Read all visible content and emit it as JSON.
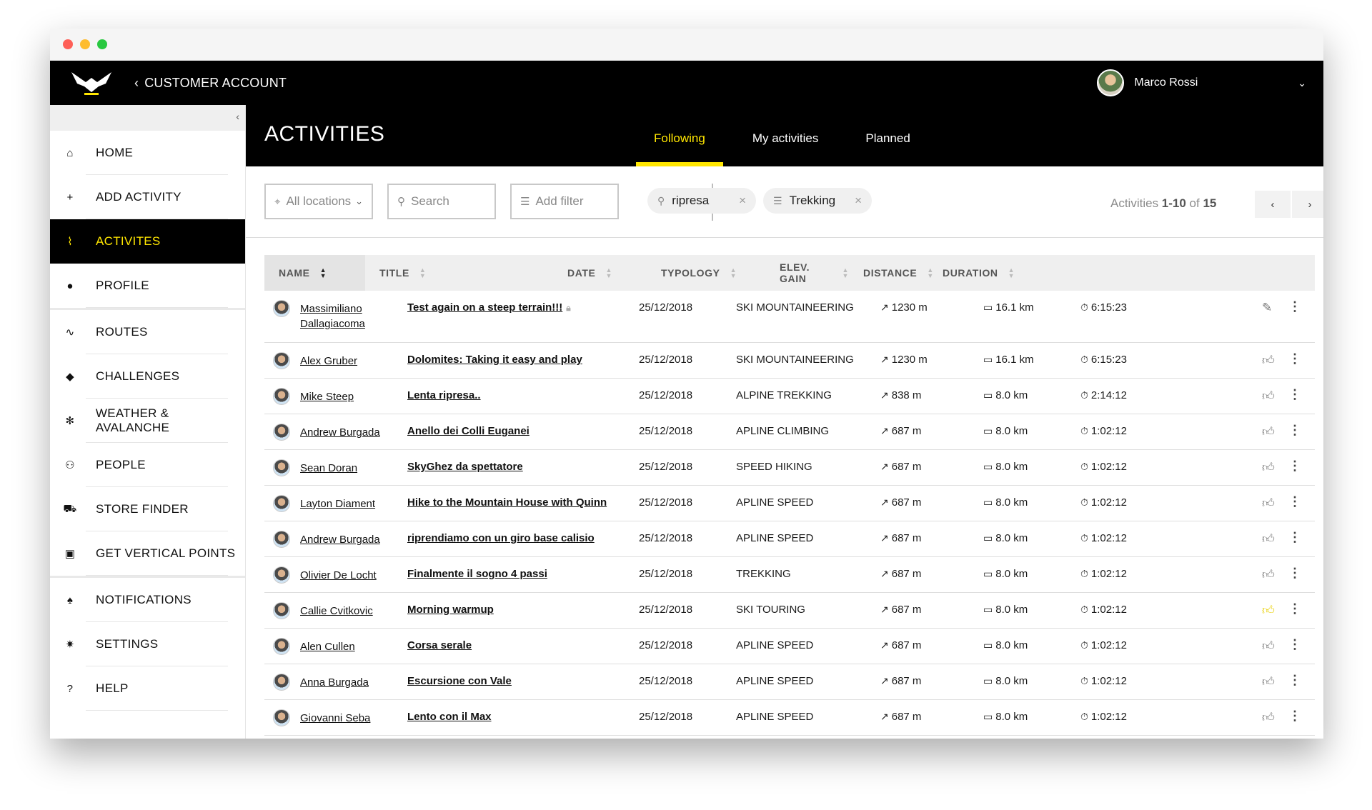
{
  "window": {
    "controls": [
      "close",
      "minimize",
      "maximize"
    ]
  },
  "topbar": {
    "logo_icon": "salewa-eagle-logo",
    "back_label": "CUSTOMER ACCOUNT",
    "user_name": "Marco Rossi"
  },
  "sidebar": {
    "items": [
      {
        "id": "home",
        "label": "HOME",
        "icon": "⌂",
        "group": 1
      },
      {
        "id": "add-activity",
        "label": "ADD ACTIVITY",
        "icon": "+",
        "group": 1
      },
      {
        "id": "activities",
        "label": "ACTIVITES",
        "icon": "⌇",
        "group": 1,
        "active": true
      },
      {
        "id": "profile",
        "label": "PROFILE",
        "icon": "●",
        "group": 1
      },
      {
        "id": "routes",
        "label": "ROUTES",
        "icon": "∿",
        "group": 2
      },
      {
        "id": "challenges",
        "label": "CHALLENGES",
        "icon": "◆",
        "group": 2
      },
      {
        "id": "weather",
        "label": "WEATHER & AVALANCHE",
        "icon": "✻",
        "group": 2
      },
      {
        "id": "people",
        "label": "PEOPLE",
        "icon": "⚇",
        "group": 2
      },
      {
        "id": "store-finder",
        "label": "STORE FINDER",
        "icon": "⛟",
        "group": 2
      },
      {
        "id": "vertical-points",
        "label": "GET VERTICAL POINTS",
        "icon": "▣",
        "group": 2
      },
      {
        "id": "notifications",
        "label": "NOTIFICATIONS",
        "icon": "♠",
        "group": 3
      },
      {
        "id": "settings",
        "label": "SETTINGS",
        "icon": "✷",
        "group": 3
      },
      {
        "id": "help",
        "label": "HELP",
        "icon": "?",
        "group": 3
      }
    ]
  },
  "main": {
    "title": "ACTIVITIES",
    "tabs": [
      {
        "label": "Following",
        "active": true
      },
      {
        "label": "My activities"
      },
      {
        "label": "Planned"
      }
    ]
  },
  "filters": {
    "locations": "All locations",
    "search_placeholder": "Search",
    "add_filter": "Add filter",
    "chips": [
      "ripresa",
      "Trekking"
    ],
    "pager": {
      "prefix": "Activities ",
      "range": "1-10",
      "of": " of ",
      "total": "15"
    }
  },
  "table": {
    "columns": [
      "NAME",
      "TITLE",
      "DATE",
      "TYPOLOGY",
      "ELEV. GAIN",
      "DISTANCE",
      "DURATION"
    ],
    "rows": [
      {
        "name": "Massimiliano Dallagiacoma",
        "title": "Test again on a steep terrain!!!",
        "private": true,
        "date": "25/12/2018",
        "typology": "SKI MOUNTAINEERING",
        "elev": "1230 m",
        "dist": "16.1 km",
        "dur": "6:15:23",
        "action": "edit"
      },
      {
        "name": "Alex Gruber",
        "title": "Dolomites: Taking it easy and play",
        "date": "25/12/2018",
        "typology": "SKI MOUNTAINEERING",
        "elev": "1230 m",
        "dist": "16.1 km",
        "dur": "6:15:23",
        "action": "like"
      },
      {
        "name": "Mike Steep",
        "title": "Lenta ripresa..",
        "date": "25/12/2018",
        "typology": "ALPINE TREKKING",
        "elev": "838 m",
        "dist": "8.0 km",
        "dur": "2:14:12",
        "action": "like"
      },
      {
        "name": "Andrew Burgada",
        "title": "Anello dei Colli Euganei",
        "date": "25/12/2018",
        "typology": "APLINE CLIMBING",
        "elev": "687 m",
        "dist": "8.0 km",
        "dur": "1:02:12",
        "action": "like"
      },
      {
        "name": "Sean Doran",
        "title": "SkyGhez da spettatore",
        "date": "25/12/2018",
        "typology": "SPEED HIKING",
        "elev": "687 m",
        "dist": "8.0 km",
        "dur": "1:02:12",
        "action": "like"
      },
      {
        "name": "Layton Diament",
        "title": "Hike to the Mountain House with Quinn",
        "date": "25/12/2018",
        "typology": "APLINE SPEED",
        "elev": "687 m",
        "dist": "8.0 km",
        "dur": "1:02:12",
        "action": "like"
      },
      {
        "name": "Andrew Burgada",
        "title": "riprendiamo con un giro base calisio",
        "date": "25/12/2018",
        "typology": "APLINE SPEED",
        "elev": "687 m",
        "dist": "8.0 km",
        "dur": "1:02:12",
        "action": "like"
      },
      {
        "name": "Olivier De Locht",
        "title": "Finalmente il sogno 4 passi",
        "date": "25/12/2018",
        "typology": "TREKKING",
        "elev": "687 m",
        "dist": "8.0 km",
        "dur": "1:02:12",
        "action": "like"
      },
      {
        "name": "Callie Cvitkovic",
        "title": "Morning warmup",
        "date": "25/12/2018",
        "typology": "SKI TOURING",
        "elev": "687 m",
        "dist": "8.0 km",
        "dur": "1:02:12",
        "action": "liked"
      },
      {
        "name": "Alen Cullen",
        "title": "Corsa serale",
        "date": "25/12/2018",
        "typology": "APLINE SPEED",
        "elev": "687 m",
        "dist": "8.0 km",
        "dur": "1:02:12",
        "action": "like"
      },
      {
        "name": "Anna Burgada",
        "title": "Escursione con Vale",
        "date": "25/12/2018",
        "typology": "APLINE SPEED",
        "elev": "687 m",
        "dist": "8.0 km",
        "dur": "1:02:12",
        "action": "like"
      },
      {
        "name": "Giovanni Seba",
        "title": "Lento con il Max",
        "date": "25/12/2018",
        "typology": "APLINE SPEED",
        "elev": "687 m",
        "dist": "8.0 km",
        "dur": "1:02:12",
        "action": "like"
      }
    ]
  },
  "colors": {
    "accent": "#ffe600",
    "header_bg": "#000000"
  }
}
